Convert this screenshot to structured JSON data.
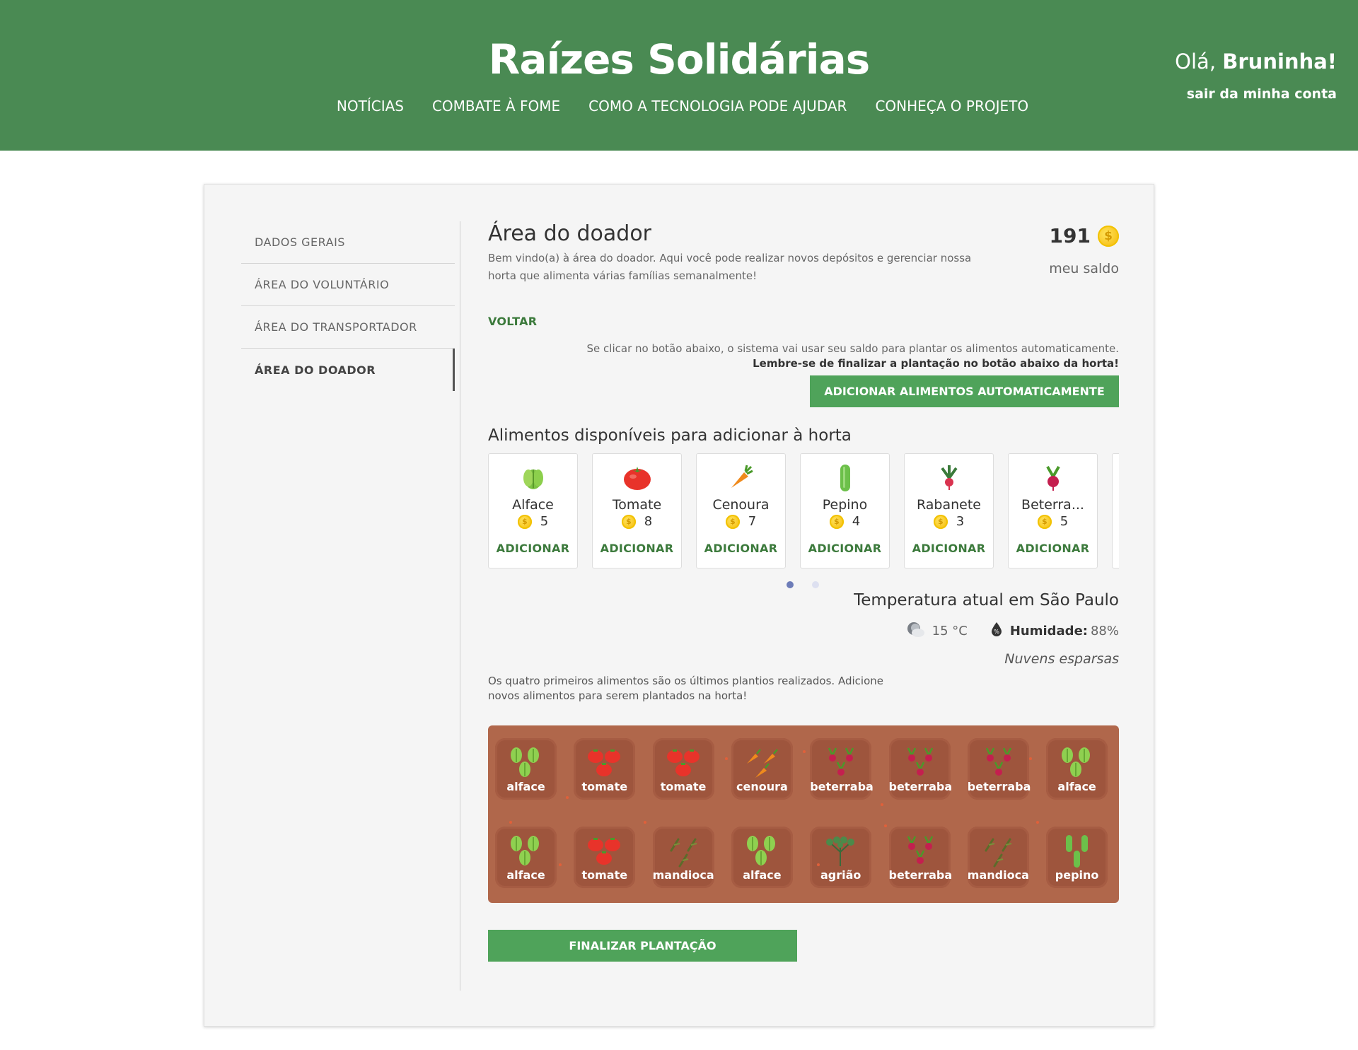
{
  "header": {
    "brand": "Raízes Solidárias",
    "nav": [
      "NOTÍCIAS",
      "COMBATE À FOME",
      "COMO A TECNOLOGIA PODE AJUDAR",
      "CONHEÇA O PROJETO"
    ],
    "greeting_prefix": "Olá,",
    "user_name": "Bruninha!",
    "logout": "sair da minha conta"
  },
  "sidebar": {
    "items": [
      "DADOS GERAIS",
      "ÁREA DO VOLUNTÁRIO",
      "ÁREA DO TRANSPORTADOR",
      "ÁREA DO DOADOR"
    ],
    "active_index": 3
  },
  "main": {
    "title": "Área do doador",
    "description": "Bem vindo(a) à área do doador. Aqui você pode realizar novos depósitos e gerenciar nossa horta que alimenta várias famílias semanalmente!",
    "balance": "191",
    "balance_label": "meu saldo",
    "back": "VOLTAR",
    "auto_info_line1": "Se clicar no botão abaixo, o sistema vai usar seu saldo para plantar os alimentos automaticamente.",
    "auto_info_line2": "Lembre-se de finalizar a plantação no botão abaixo da horta!",
    "auto_button": "ADICIONAR ALIMENTOS AUTOMATICAMENTE",
    "available_title": "Alimentos disponíveis para adicionar à horta",
    "add_label": "ADICIONAR",
    "foods": [
      {
        "name": "Alface",
        "price": "5",
        "icon": "lettuce-icon"
      },
      {
        "name": "Tomate",
        "price": "8",
        "icon": "tomato-icon"
      },
      {
        "name": "Cenoura",
        "price": "7",
        "icon": "carrot-icon"
      },
      {
        "name": "Pepino",
        "price": "4",
        "icon": "cucumber-icon"
      },
      {
        "name": "Rabanete",
        "price": "3",
        "icon": "radish-icon"
      },
      {
        "name": "Beterra...",
        "price": "5",
        "icon": "beet-icon"
      }
    ],
    "carousel_page": 1,
    "carousel_pages": 2,
    "weather": {
      "title": "Temperatura atual em São Paulo",
      "temperature": "15 °C",
      "humidity_label": "Humidade:",
      "humidity_value": "88%",
      "description": "Nuvens esparsas"
    },
    "garden_info": "Os quatro primeiros alimentos são os últimos plantios realizados. Adicione novos alimentos para serem plantados na horta!",
    "garden": [
      {
        "label": "alface",
        "icon": "lettuce-icon"
      },
      {
        "label": "tomate",
        "icon": "tomato-icon"
      },
      {
        "label": "tomate",
        "icon": "tomato-icon"
      },
      {
        "label": "cenoura",
        "icon": "carrot-icon"
      },
      {
        "label": "beterraba",
        "icon": "beet-icon"
      },
      {
        "label": "beterraba",
        "icon": "beet-icon"
      },
      {
        "label": "beterraba",
        "icon": "beet-icon"
      },
      {
        "label": "alface",
        "icon": "lettuce-icon"
      },
      {
        "label": "alface",
        "icon": "lettuce-icon"
      },
      {
        "label": "tomate",
        "icon": "tomato-icon"
      },
      {
        "label": "mandioca",
        "icon": "cassava-icon"
      },
      {
        "label": "alface",
        "icon": "lettuce-icon"
      },
      {
        "label": "agrião",
        "icon": "watercress-icon"
      },
      {
        "label": "beterraba",
        "icon": "beet-icon"
      },
      {
        "label": "mandioca",
        "icon": "cassava-icon"
      },
      {
        "label": "pepino",
        "icon": "cucumber-icon"
      }
    ],
    "finish_button": "FINALIZAR PLANTAÇÃO"
  },
  "colors": {
    "header_green": "#4a8a53",
    "button_green": "#4fa35a",
    "link_green": "#3c7a3c",
    "garden_soil": "#b0674b",
    "plot_soil": "#9e553d",
    "coin": "#f4b400"
  }
}
